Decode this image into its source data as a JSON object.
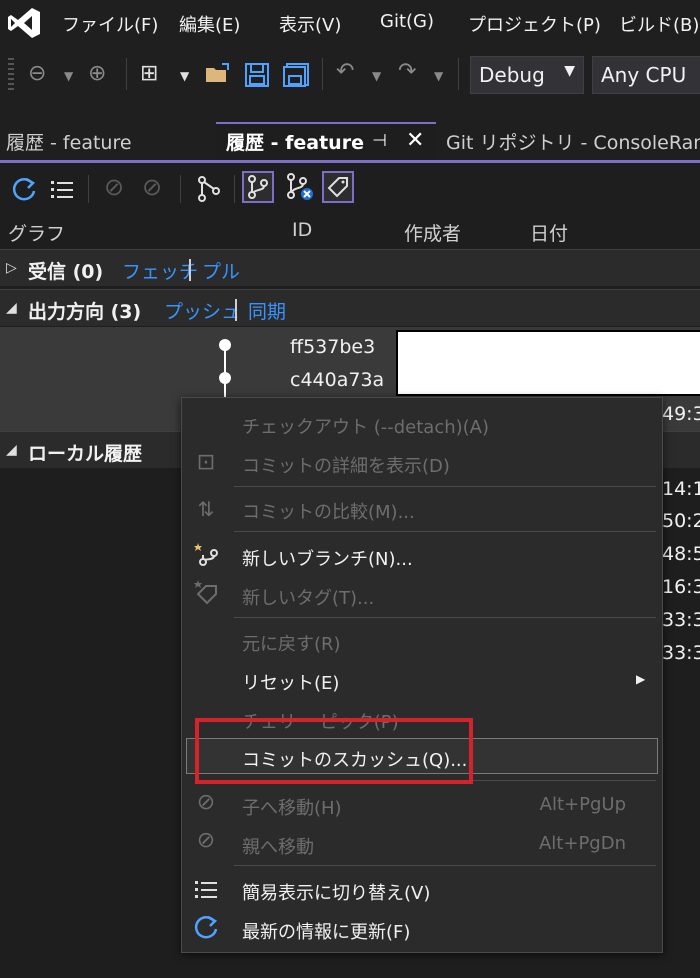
{
  "menubar": {
    "items": [
      "ファイル(F)",
      "編集(E)",
      "表示(V)",
      "Git(G)",
      "プロジェクト(P)",
      "ビルド(B)"
    ]
  },
  "toolbar": {
    "config": "Debug",
    "platform": "Any CPU"
  },
  "tabs": [
    {
      "label": "履歴 - feature",
      "active": false
    },
    {
      "label": "履歴 - feature",
      "active": true
    },
    {
      "label": "Git リポジトリ - ConsoleRand",
      "active": false
    }
  ],
  "columns": [
    "グラフ",
    "ID",
    "作成者",
    "日付"
  ],
  "incoming": {
    "title": "受信 (0)",
    "fetch": "フェッチ",
    "pull": "プル"
  },
  "outgoing": {
    "title": "出力方向 (3)",
    "push": "プッシュ",
    "sync": "同期",
    "commits": [
      "ff537be3",
      "c440a73a"
    ],
    "time_tail": "49:3"
  },
  "local": {
    "title": "ローカル履歴",
    "time_tails": [
      "14:1",
      "50:2",
      "48:5",
      "16:3",
      "33:3",
      "33:3"
    ]
  },
  "context_menu": {
    "items": [
      {
        "label": "チェックアウト (--detach)(A)",
        "enabled": false
      },
      {
        "label": "コミットの詳細を表示(D)",
        "enabled": false
      },
      {
        "label": "コミットの比較(M)...",
        "enabled": false
      },
      {
        "label": "新しいブランチ(N)...",
        "enabled": true
      },
      {
        "label": "新しいタグ(T)...",
        "enabled": false
      },
      {
        "label": "元に戻す(R)",
        "enabled": false
      },
      {
        "label": "リセット(E)",
        "enabled": true
      },
      {
        "label": "チェリー ピック(P)",
        "enabled": false
      },
      {
        "label": "コミットのスカッシュ(Q)...",
        "enabled": true
      },
      {
        "label": "子へ移動(H)",
        "enabled": false,
        "shortcut": "Alt+PgUp"
      },
      {
        "label": "親へ移動",
        "enabled": false,
        "shortcut": "Alt+PgDn"
      },
      {
        "label": "簡易表示に切り替え(V)",
        "enabled": true
      },
      {
        "label": "最新の情報に更新(F)",
        "enabled": true
      }
    ]
  },
  "colors": {
    "accent": "#7f6ec7",
    "link": "#3794ff",
    "highlight_box": "#d4232a"
  }
}
